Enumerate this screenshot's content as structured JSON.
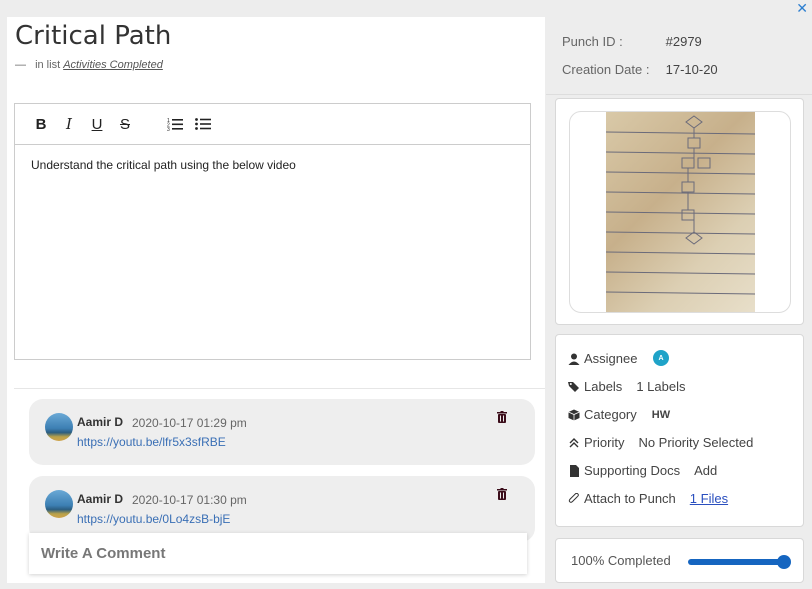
{
  "task": {
    "title": "Critical Path",
    "list_prefix": "in list",
    "list_name": "Activities Completed"
  },
  "editor": {
    "toolbar": {
      "bold": "B",
      "italic": "I",
      "underline": "U",
      "strike": "S",
      "ordered_list": "ordered-list-icon",
      "bullet_list": "bullet-list-icon"
    },
    "content": "Understand the critical path using the below video"
  },
  "comments": [
    {
      "author": "Aamir D",
      "time": "2020-10-17 01:29 pm",
      "link": "https://youtu.be/lfr5x3sfRBE"
    },
    {
      "author": "Aamir D",
      "time": "2020-10-17 01:30 pm",
      "link": "https://youtu.be/0Lo4zsB-bjE"
    }
  ],
  "comment_input": {
    "placeholder": "Write A Comment"
  },
  "meta": {
    "punch_id_label": "Punch ID :",
    "punch_id": "#2979",
    "creation_label": "Creation Date :",
    "creation_date": "17-10-20"
  },
  "props": {
    "assignee_label": "Assignee",
    "assignee_initial": "A",
    "labels_label": "Labels",
    "labels_value": "1 Labels",
    "category_label": "Category",
    "category_value": "HW",
    "priority_label": "Priority",
    "priority_value": "No Priority Selected",
    "docs_label": "Supporting Docs",
    "docs_value": "Add",
    "attach_label": "Attach to Punch",
    "attach_value": "1 Files"
  },
  "progress": {
    "label": "100% Completed",
    "percent": 100
  },
  "colors": {
    "accent": "#1565c0",
    "badge": "#1fa3c8",
    "link": "#3a6fb5"
  }
}
